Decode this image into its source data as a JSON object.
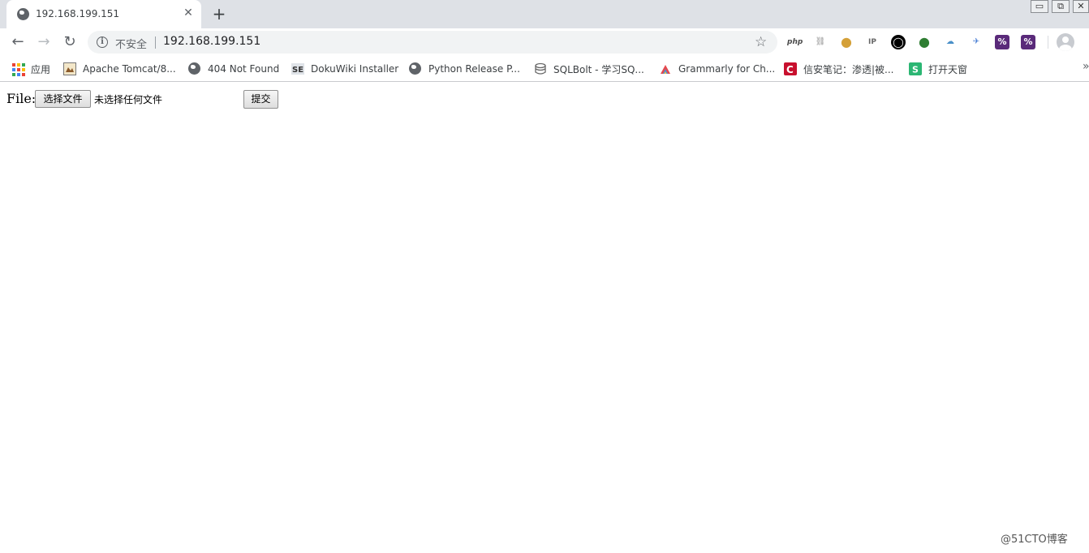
{
  "window": {
    "minimize": "▭",
    "restore": "⧉",
    "close": "✕"
  },
  "tab": {
    "title": "192.168.199.151",
    "close_glyph": "✕",
    "new_tab_glyph": "+"
  },
  "toolbar": {
    "back_glyph": "←",
    "forward_glyph": "→",
    "reload_glyph": "↻",
    "info_glyph": "i",
    "security_text": "不安全",
    "url": "192.168.199.151",
    "star_glyph": "☆"
  },
  "extensions": [
    {
      "name": "php-extension-icon",
      "label": "php",
      "color": "#ffffff",
      "text_color": "#4a4a4a"
    },
    {
      "name": "chain-link-extension-icon",
      "label": "⛓",
      "color": "#ffffff",
      "text_color": "#8a8a8a"
    },
    {
      "name": "cookie-extension-icon",
      "label": "●",
      "color": "#ffffff",
      "text_color": "#d4a038"
    },
    {
      "name": "ip-search-extension-icon",
      "label": "IP",
      "color": "#ffffff",
      "text_color": "#666666"
    },
    {
      "name": "circle-extension-icon",
      "label": "◯",
      "color": "#000000",
      "text_color": "#ffffff"
    },
    {
      "name": "green-globe-extension-icon",
      "label": "●",
      "color": "#ffffff",
      "text_color": "#2e7d32"
    },
    {
      "name": "cloud-extension-icon",
      "label": "☁",
      "color": "#ffffff",
      "text_color": "#4a90c8"
    },
    {
      "name": "bird-extension-icon",
      "label": "✈",
      "color": "#ffffff",
      "text_color": "#4a7fd4"
    },
    {
      "name": "hackbar-extension-icon",
      "label": "%",
      "color": "#5a2a7a",
      "text_color": "#ffffff"
    },
    {
      "name": "hackbar-alt-extension-icon",
      "label": "%",
      "color": "#5a2a7a",
      "text_color": "#ffffff"
    }
  ],
  "bookmarks": [
    {
      "name": "bookmark-apps",
      "label": "应用",
      "icon": "apps-grid-icon"
    },
    {
      "name": "bookmark-apache-tomcat",
      "label": "Apache Tomcat/8...",
      "icon": "tomcat-icon"
    },
    {
      "name": "bookmark-404",
      "label": "404 Not Found",
      "icon": "globe-icon"
    },
    {
      "name": "bookmark-dokuwiki",
      "label": "DokuWiki Installer",
      "icon": "dokuwiki-icon"
    },
    {
      "name": "bookmark-python",
      "label": "Python Release P...",
      "icon": "globe-icon"
    },
    {
      "name": "bookmark-sqlbolt",
      "label": "SQLBolt - 学习SQ...",
      "icon": "database-icon"
    },
    {
      "name": "bookmark-grammarly",
      "label": "Grammarly for Ch...",
      "icon": "grammarly-icon"
    },
    {
      "name": "bookmark-xinan",
      "label": "信安笔记：渗透|被...",
      "icon": "red-c-icon"
    },
    {
      "name": "bookmark-tianchuang",
      "label": "打开天窗",
      "icon": "green-s-icon"
    }
  ],
  "bookmarks_overflow": "»",
  "colors": {
    "apps_grid": [
      "#ea4335",
      "#fbbc04",
      "#34a853",
      "#4285f4",
      "#ea4335",
      "#fbbc04",
      "#34a853",
      "#4285f4",
      "#ea4335"
    ]
  },
  "form": {
    "file_label": "File:",
    "choose_button": "选择文件",
    "no_file_text": "未选择任何文件",
    "submit_button": "提交"
  },
  "watermark": "@51CTO博客"
}
